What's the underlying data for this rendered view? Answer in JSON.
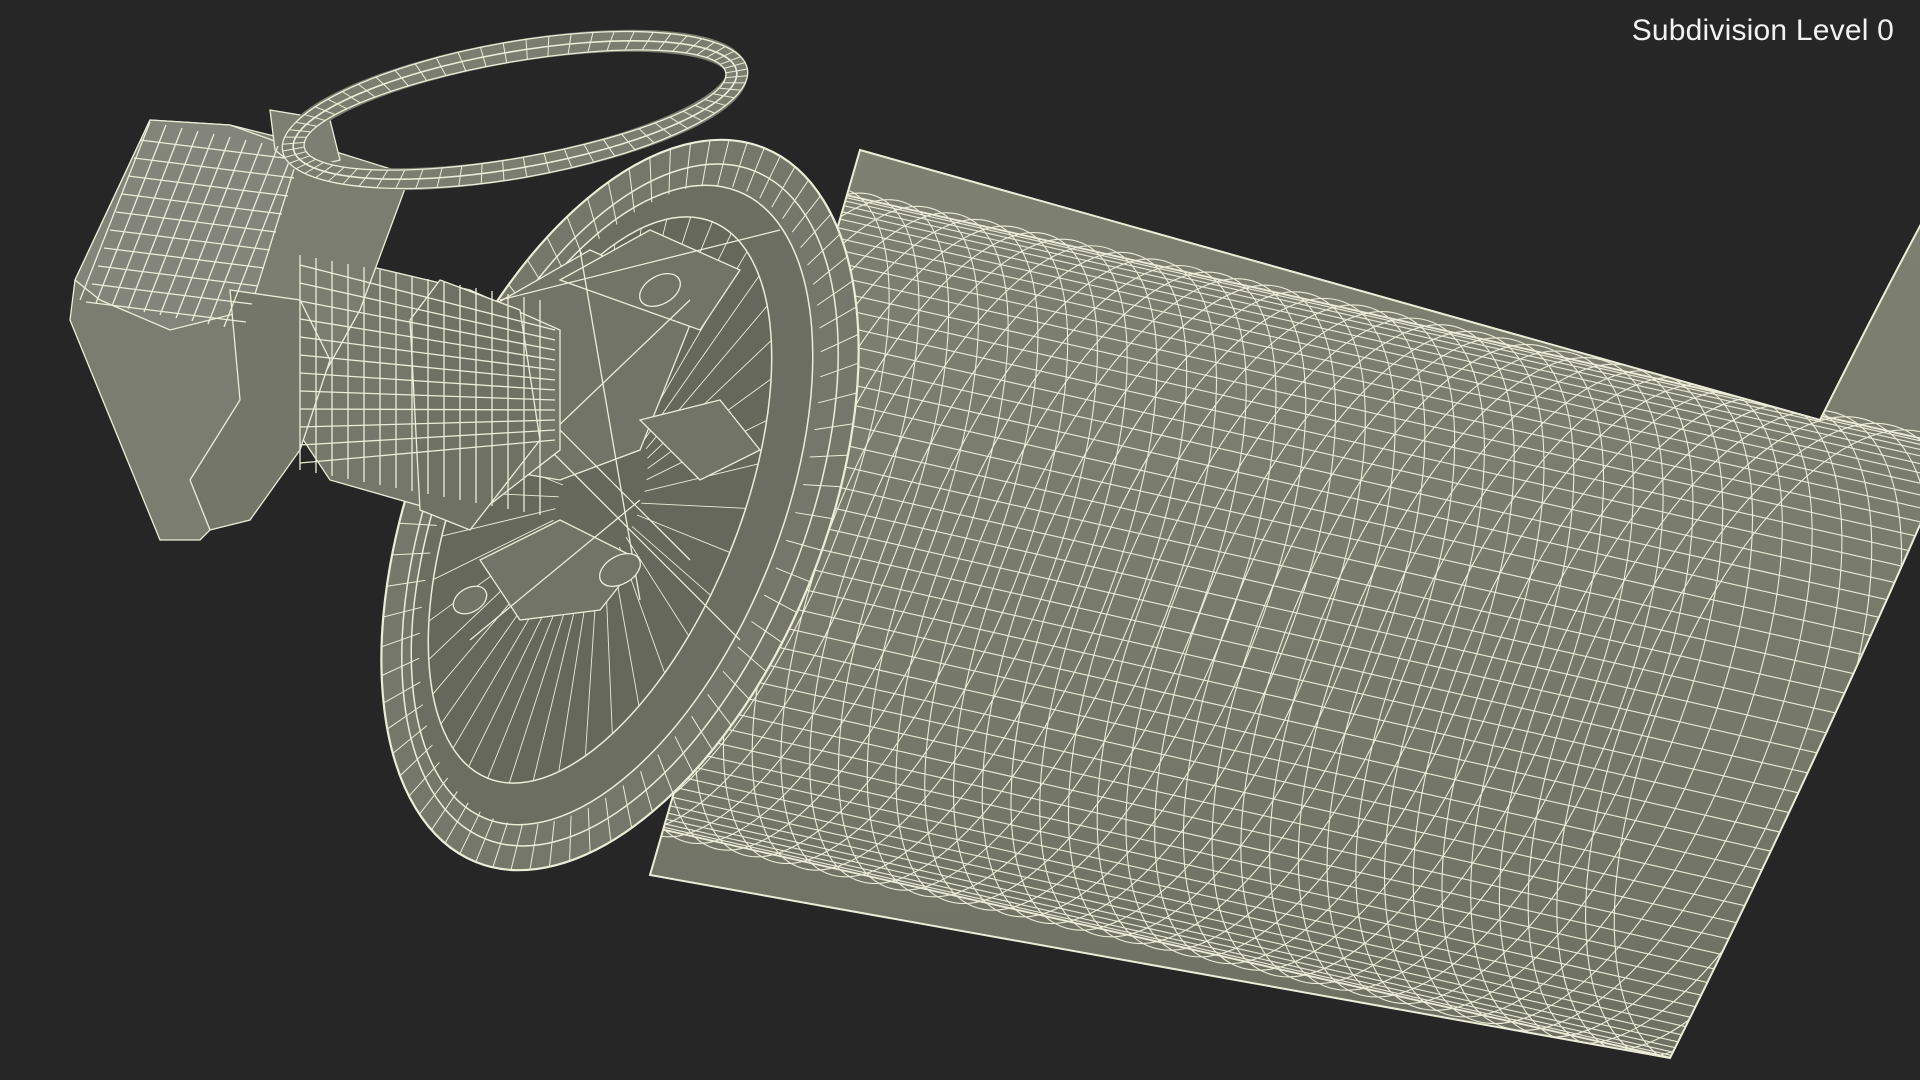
{
  "viewport": {
    "label": "Subdivision Level 0"
  },
  "colors": {
    "background": "#262626",
    "surface": "#797b6d",
    "surface_dark": "#5f6155",
    "wire": "#ecedd8"
  }
}
